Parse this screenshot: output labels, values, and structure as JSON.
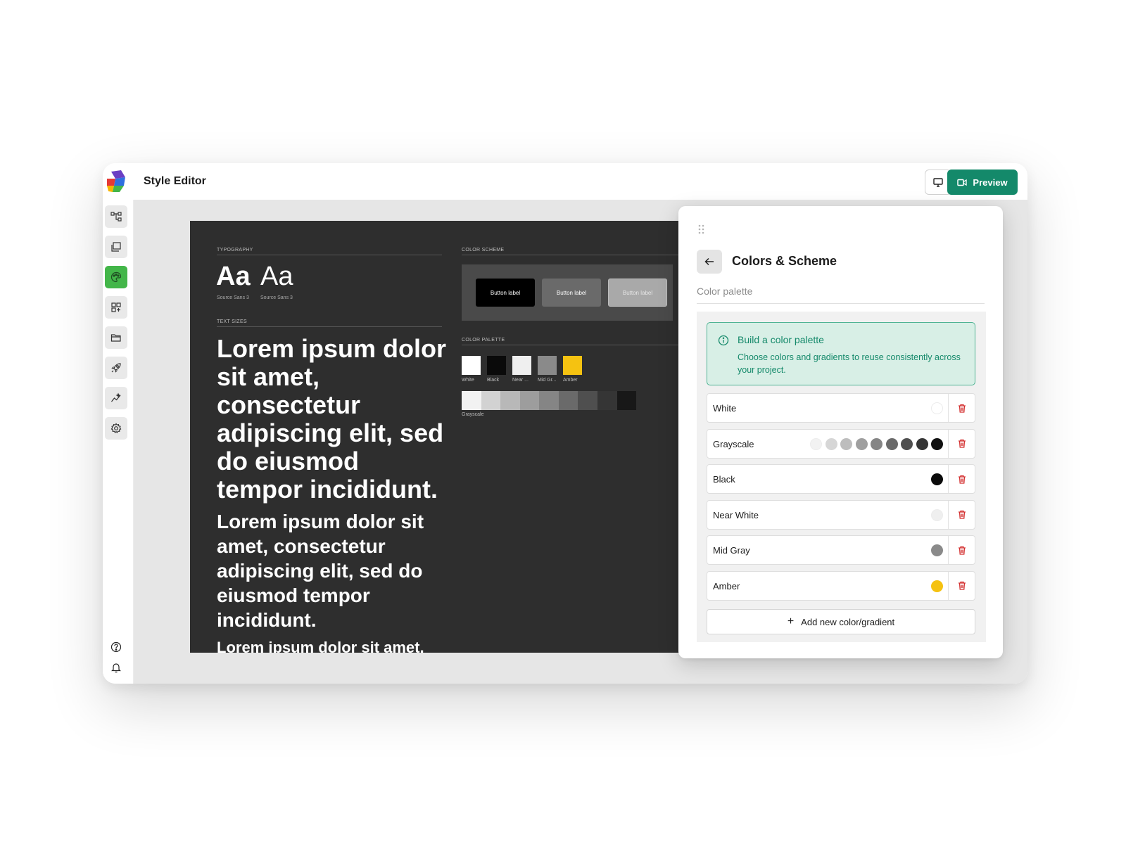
{
  "app": {
    "title": "Style Editor",
    "preview_label": "Preview",
    "accent": "#14896a"
  },
  "rail": {
    "items": [
      {
        "icon": "sitemap-icon"
      },
      {
        "icon": "pages-icon"
      },
      {
        "icon": "palette-icon",
        "active": true
      },
      {
        "icon": "widgets-icon"
      },
      {
        "icon": "folder-icon"
      },
      {
        "icon": "rocket-icon"
      },
      {
        "icon": "analytics-icon"
      },
      {
        "icon": "settings-icon"
      }
    ],
    "bottom": [
      {
        "icon": "help-icon"
      },
      {
        "icon": "bell-icon"
      },
      {
        "icon": "avatar"
      }
    ]
  },
  "doc": {
    "typography_label": "TYPOGRAPHY",
    "font_samples": [
      {
        "glyphs": "Aa",
        "name": "Source Sans 3"
      },
      {
        "glyphs": "Aa",
        "name": "Source Sans 3"
      }
    ],
    "text_sizes_label": "TEXT SIZES",
    "lorem_xl": "Lorem ipsum dolor sit amet, consectetur adipiscing elit, sed do eiusmod tempor incididunt.",
    "lorem_lg": "Lorem ipsum dolor sit amet, consectetur adipiscing elit, sed do eiusmod tempor incididunt.",
    "lorem_md": "Lorem ipsum dolor sit amet,",
    "color_scheme_label": "COLOR SCHEME",
    "scheme_buttons": [
      "Button label",
      "Button label",
      "Button label"
    ],
    "color_palette_label": "COLOR PALETTE",
    "swatches": [
      {
        "name": "White",
        "color": "#ffffff"
      },
      {
        "name": "Black",
        "color": "#0a0a0a"
      },
      {
        "name": "Near ...",
        "color": "#efefef"
      },
      {
        "name": "Mid Gr...",
        "color": "#8a8a8a"
      },
      {
        "name": "Amber",
        "color": "#f5c211"
      }
    ],
    "grayscale_label": "Grayscale",
    "grayscale": [
      "#f2f2f2",
      "#d2d2d2",
      "#b8b8b8",
      "#9d9d9d",
      "#858585",
      "#6a6a6a",
      "#4f4f4f",
      "#353535",
      "#181818"
    ]
  },
  "panel": {
    "title": "Colors & Scheme",
    "subtitle": "Color palette",
    "info_title": "Build a color palette",
    "info_text": "Choose colors and gradients to reuse consistently across your project.",
    "colors": [
      {
        "name": "White",
        "swatches": [
          "#ffffff"
        ]
      },
      {
        "name": "Grayscale",
        "swatches": [
          "#f2f2f2",
          "#d6d6d6",
          "#bdbdbd",
          "#9f9f9f",
          "#858585",
          "#6a6a6a",
          "#4f4f4f",
          "#353535",
          "#111111"
        ]
      },
      {
        "name": "Black",
        "swatches": [
          "#0b0b0b"
        ]
      },
      {
        "name": "Near White",
        "swatches": [
          "#efefef"
        ]
      },
      {
        "name": "Mid Gray",
        "swatches": [
          "#8a8a8a"
        ]
      },
      {
        "name": "Amber",
        "swatches": [
          "#f5c211"
        ]
      }
    ],
    "add_label": "Add new color/gradient",
    "add_icon": "+"
  }
}
